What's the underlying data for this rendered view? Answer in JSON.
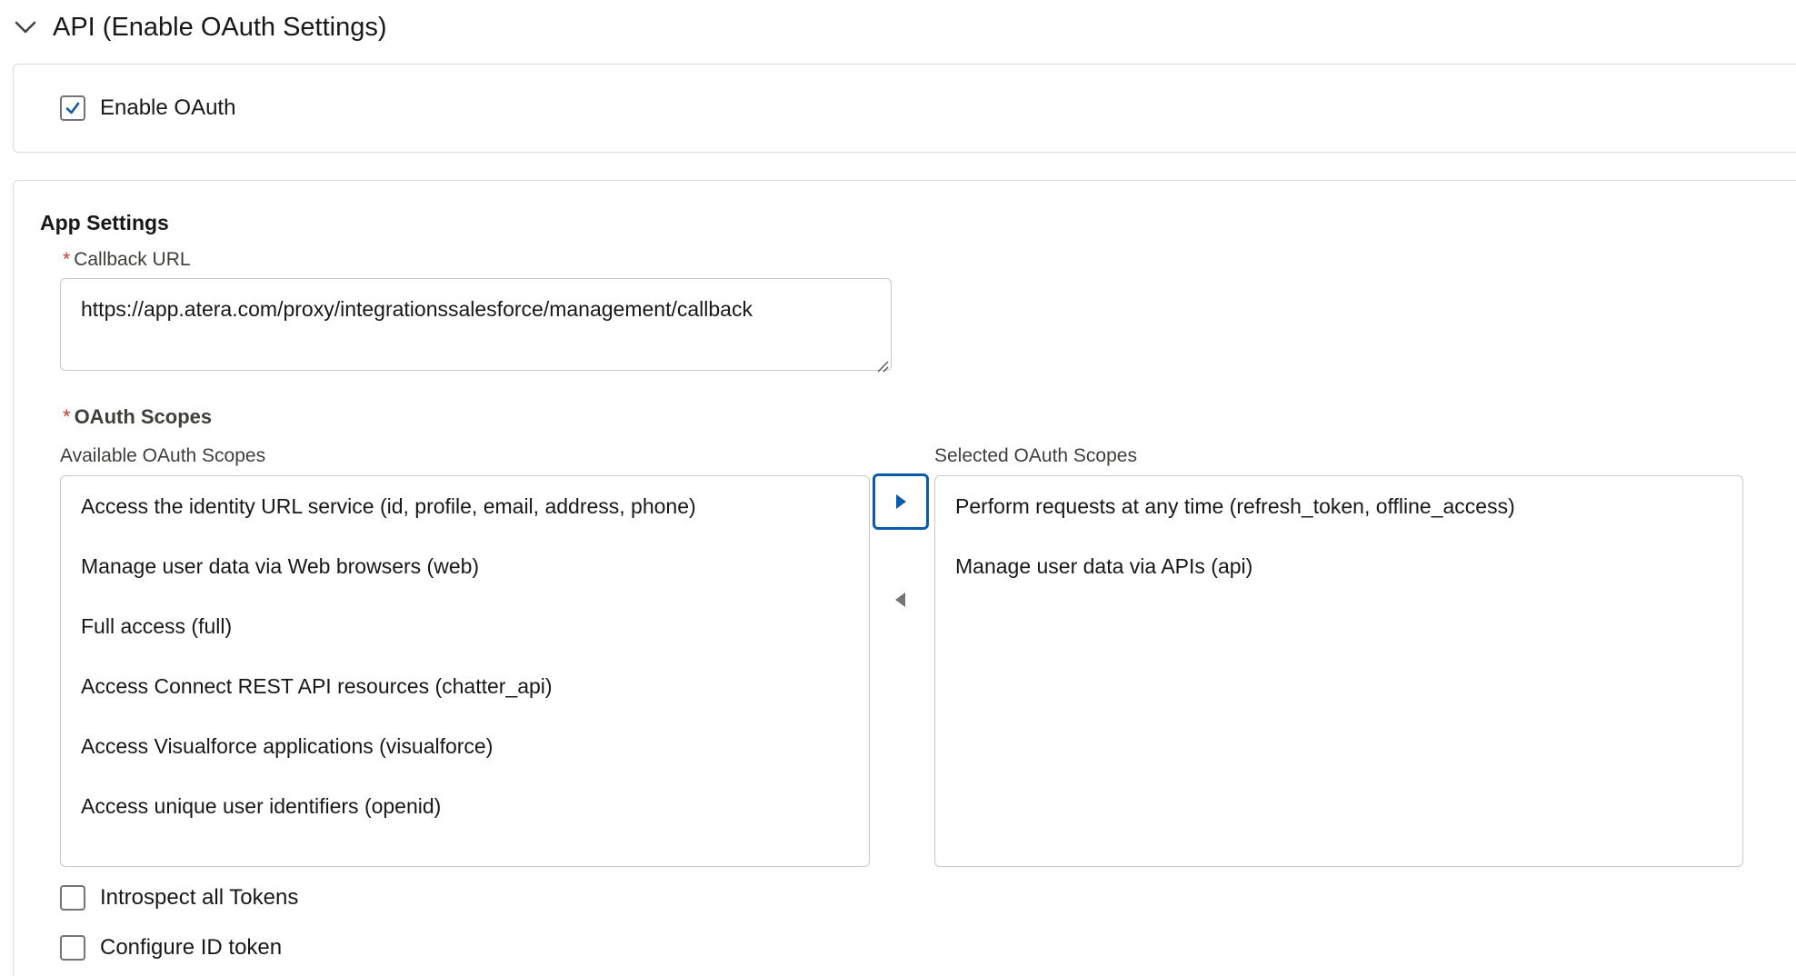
{
  "section": {
    "title": "API (Enable OAuth Settings)",
    "collapse_icon": "chevron-down-icon"
  },
  "enable_oauth": {
    "label": "Enable OAuth",
    "checked": true
  },
  "app_settings": {
    "title": "App Settings",
    "callback_url": {
      "required_marker": "*",
      "label": "Callback URL",
      "value": "https://app.atera.com/proxy/integrationssalesforce/management/callback"
    },
    "oauth_scopes": {
      "required_marker": "*",
      "title": "OAuth Scopes",
      "available_label": "Available OAuth Scopes",
      "selected_label": "Selected OAuth Scopes",
      "available": [
        "Access the identity URL service (id, profile, email, address, phone)",
        "Manage user data via Web browsers (web)",
        "Full access (full)",
        "Access Connect REST API resources (chatter_api)",
        "Access Visualforce applications (visualforce)",
        "Access unique user identifiers (openid)"
      ],
      "selected": [
        "Perform requests at any time (refresh_token, offline_access)",
        "Manage user data via APIs (api)"
      ],
      "move_right_icon": "triangle-right-icon",
      "move_left_icon": "triangle-left-icon"
    },
    "introspect_tokens": {
      "label": "Introspect all Tokens",
      "checked": false
    },
    "configure_id_token": {
      "label": "Configure ID token",
      "checked": false
    }
  },
  "colors": {
    "accent": "#0b5cab",
    "required": "#c23934",
    "border": "#c9c9c9"
  }
}
